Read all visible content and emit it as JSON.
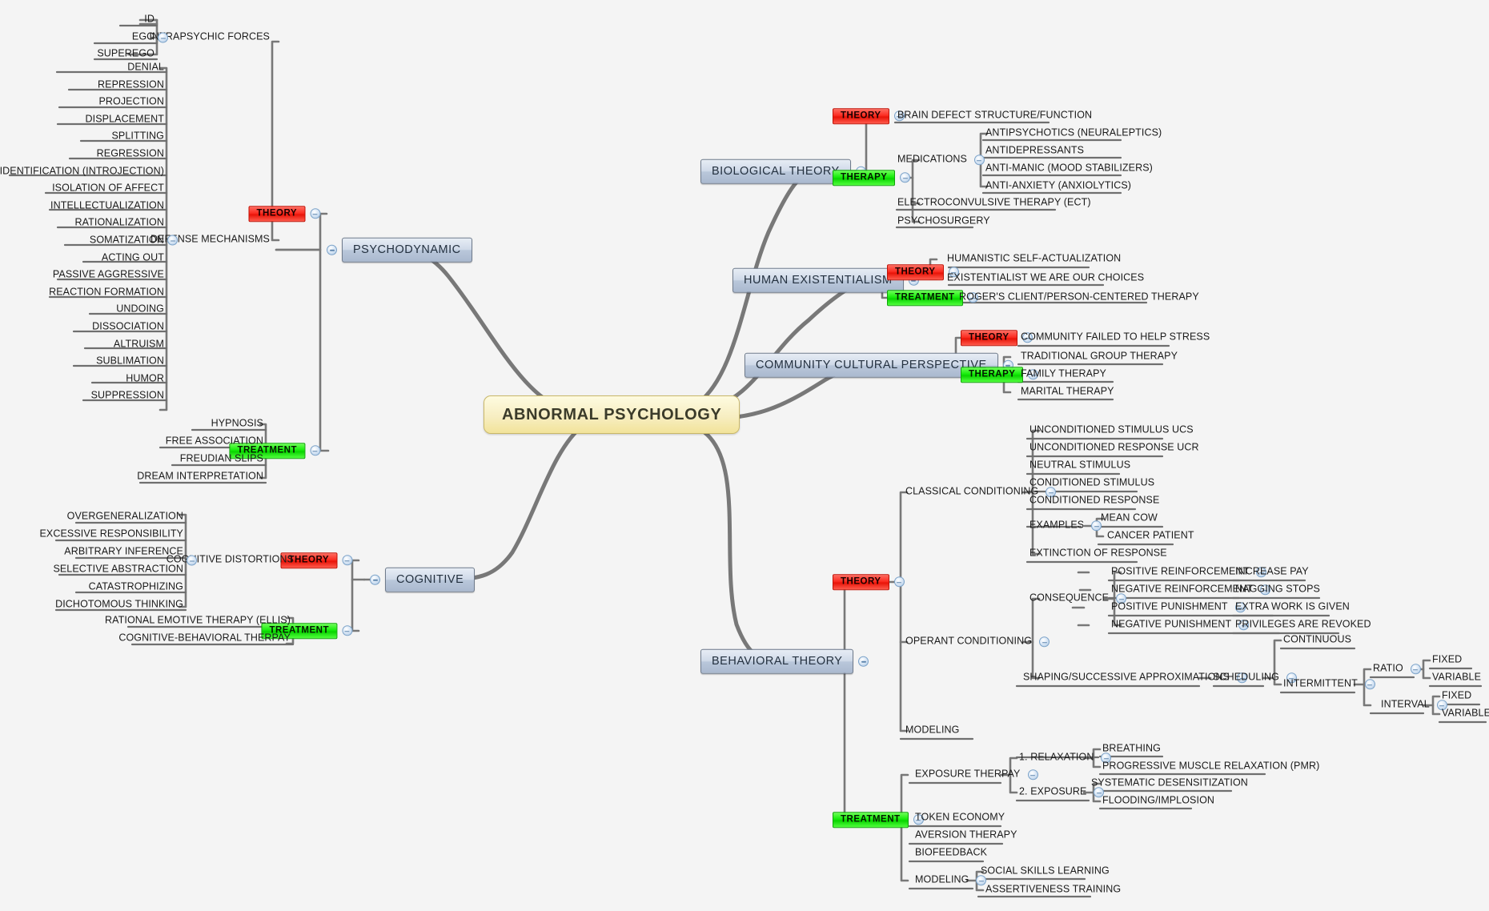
{
  "title": "Abnormal Psychology Mind Map",
  "palette": {
    "background": "#f4f4f4",
    "root_fill": "#f7eec2",
    "root_border": "#c9b869",
    "branch_fill": "#c3d0e0",
    "branch_border": "#6f7b8c",
    "theory_chip": "#ee1a0c",
    "therapy_chip": "#11e008",
    "wire": "#777777",
    "text": "#1a1a1a"
  },
  "root": {
    "label": "ABNORMAL PSYCHOLOGY"
  },
  "chips": {
    "theory": "THEORY",
    "therapy": "THERAPY",
    "treatment": "TREATMENT"
  },
  "branches": {
    "psychodynamic": "PSYCHODYNAMIC",
    "cognitive": "COGNITIVE",
    "biological": "BIOLOGICAL THEORY",
    "human_existentialism": "HUMAN EXISTENTIALISM",
    "community": "COMMUNITY CULTURAL PERSPECTIVE",
    "behavioral": "BEHAVIORAL THEORY"
  },
  "psychodynamic": {
    "theory_groups": {
      "intrapsychic": "INTRAPSYCHIC FORCES",
      "intrapsychic_items": [
        "ID",
        "EGO",
        "SUPEREGO"
      ],
      "defense": "DEFENSE MECHANISMS",
      "defense_items": [
        "DENIAL",
        "REPRESSION",
        "PROJECTION",
        "DISPLACEMENT",
        "SPLITTING",
        "REGRESSION",
        "IDENTIFICATION (INTROJECTION)",
        "ISOLATION OF AFFECT",
        "INTELLECTUALIZATION",
        "RATIONALIZATION",
        "SOMATIZATION",
        "ACTING OUT",
        "PASSIVE AGGRESSIVE",
        "REACTION FORMATION",
        "UNDOING",
        "DISSOCIATION",
        "ALTRUISM",
        "SUBLIMATION",
        "HUMOR",
        "SUPPRESSION"
      ]
    },
    "treatment_items": [
      "HYPNOSIS",
      "FREE ASSOCIATION",
      "FREUDIAN SLIPS",
      "DREAM INTERPRETATION"
    ]
  },
  "cognitive": {
    "distortions_label": "COGNITIVE DISTORTIONS",
    "distortions": [
      "OVERGENERALIZATION",
      "EXCESSIVE RESPONSIBILITY",
      "ARBITRARY INFERENCE",
      "SELECTIVE ABSTRACTION",
      "CATASTROPHIZING",
      "DICHOTOMOUS THINKING"
    ],
    "treatment_items": [
      "RATIONAL EMOTIVE THERAPY (ELLIS)",
      "COGNITIVE-BEHAVIORAL THERPAY"
    ]
  },
  "biological": {
    "theory_item": "BRAIN DEFECT STRUCTURE/FUNCTION",
    "medications_label": "MEDICATIONS",
    "medications": [
      "ANTIPSYCHOTICS (NEURALEPTICS)",
      "ANTIDEPRESSANTS",
      "ANTI-MANIC (MOOD STABILIZERS)",
      "ANTI-ANXIETY (ANXIOLYTICS)"
    ],
    "therapy_other": [
      "ELECTROCONVULSIVE THERAPY (ECT)",
      "PSYCHOSURGERY"
    ]
  },
  "human_existentialism": {
    "theory_items": [
      "HUMANISTIC SELF-ACTUALIZATION",
      "EXISTENTIALIST WE ARE OUR CHOICES"
    ],
    "treatment_items": [
      "ROGER'S CLIENT/PERSON-CENTERED THERAPY"
    ]
  },
  "community": {
    "theory_items": [
      "COMMUNITY FAILED TO HELP STRESS"
    ],
    "therapy_items": [
      "TRADITIONAL GROUP THERAPY",
      "FAMILY THERAPY",
      "MARITAL THERAPY"
    ]
  },
  "behavioral": {
    "classical_label": "CLASSICAL CONDITIONING",
    "classical_items": [
      "UNCONDITIONED STIMULUS UCS",
      "UNCONDITIONED RESPONSE UCR",
      "NEUTRAL STIMULUS",
      "CONDITIONED STIMULUS",
      "CONDITIONED RESPONSE"
    ],
    "examples_label": "EXAMPLES",
    "examples": [
      "MEAN COW",
      "CANCER PATIENT"
    ],
    "extinction": "EXTINCTION OF RESPONSE",
    "operant_label": "OPERANT CONDITIONING",
    "consequence_label": "CONSEQUENCE",
    "consequences": [
      {
        "name": "POSITIVE REINFORCEMENT",
        "example": "INCREASE PAY"
      },
      {
        "name": "NEGATIVE REINFORCEMENT",
        "example": "NAGGING STOPS"
      },
      {
        "name": "POSITIVE PUNISHMENT",
        "example": "EXTRA WORK IS GIVEN"
      },
      {
        "name": "NEGATIVE PUNISHMENT",
        "example": "PRIVILEGES ARE REVOKED"
      }
    ],
    "shaping_label": "SHAPING/SUCCESSIVE APPROXIMATIONS",
    "scheduling_label": "SCHEDULING",
    "continuous": "CONTINUOUS",
    "intermittent": "INTERMITTENT",
    "ratio": "RATIO",
    "interval": "INTERVAL",
    "ratio_items": [
      "FIXED",
      "VARIABLE"
    ],
    "interval_items": [
      "FIXED",
      "VARIABLE"
    ],
    "modeling_theory": "MODELING",
    "exposure_label": "EXPOSURE THERPAY",
    "relaxation_label": "1. RELAXATION",
    "relaxation_items": [
      "BREATHING",
      "PROGRESSIVE MUSCLE RELAXATION (PMR)"
    ],
    "exposure_step_label": "2. EXPOSURE",
    "exposure_items": [
      "SYSTEMATIC DESENSITIZATION",
      "FLOODING/IMPLOSION"
    ],
    "treatment_simple": [
      "TOKEN ECONOMY",
      "AVERSION THERAPY",
      "BIOFEEDBACK"
    ],
    "modeling_treatment_label": "MODELING",
    "modeling_items": [
      "SOCIAL SKILLS LEARNING",
      "ASSERTIVENESS TRAINING"
    ]
  }
}
